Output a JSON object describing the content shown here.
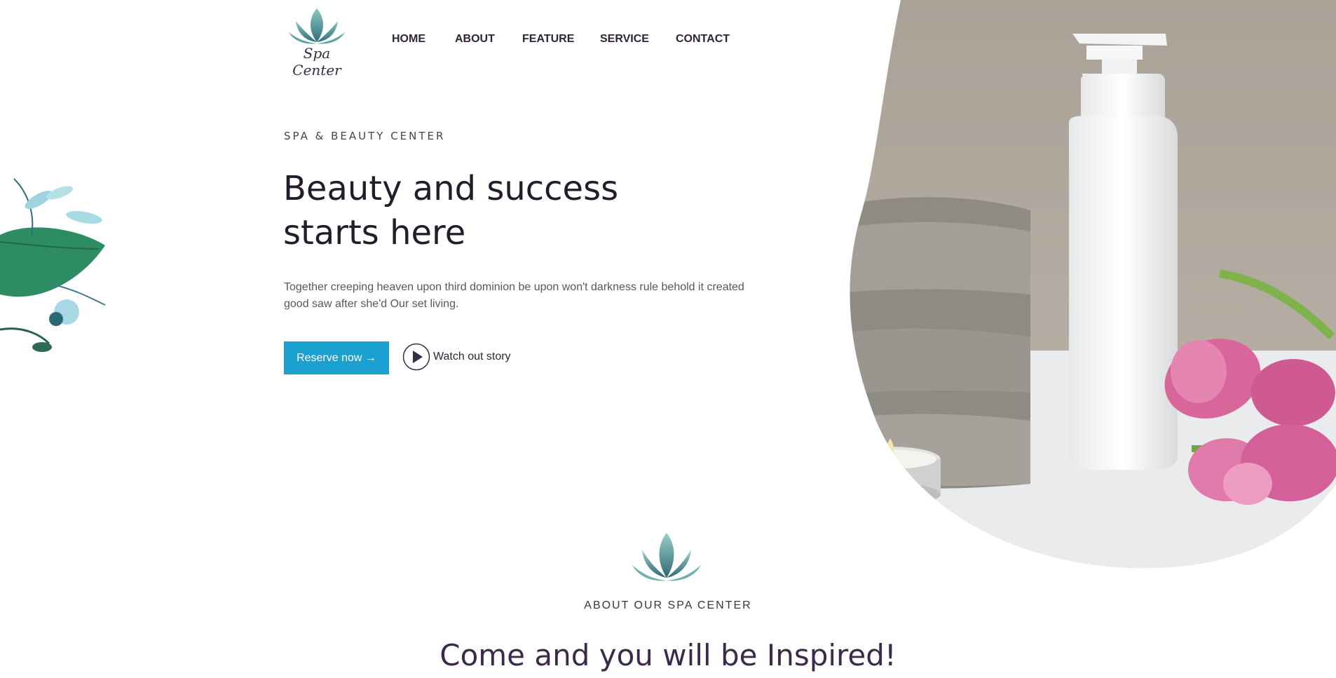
{
  "brand": {
    "logo_text": "Spa Center",
    "color": "#3b2b45",
    "accent": "#4f9a9a"
  },
  "nav": {
    "items": [
      "HOME",
      "ABOUT",
      "FEATURE",
      "SERVICE",
      "CONTACT"
    ]
  },
  "hero": {
    "eyebrow": "SPA & BEAUTY CENTER",
    "title": "Beauty and success starts here",
    "text": "Together creeping heaven upon third dominion be upon won't darkness rule behold it created good saw after she'd Our set living.",
    "reserve_label": "Reserve now →",
    "watch_label": "Watch out story",
    "button_color": "#1aa1cf"
  },
  "about": {
    "eyebrow": "ABOUT OUR SPA CENTER",
    "title": "Come and you will be Inspired!"
  },
  "icons": [
    "lotus-logo-icon",
    "play-icon",
    "leaf-decoration-icon"
  ]
}
